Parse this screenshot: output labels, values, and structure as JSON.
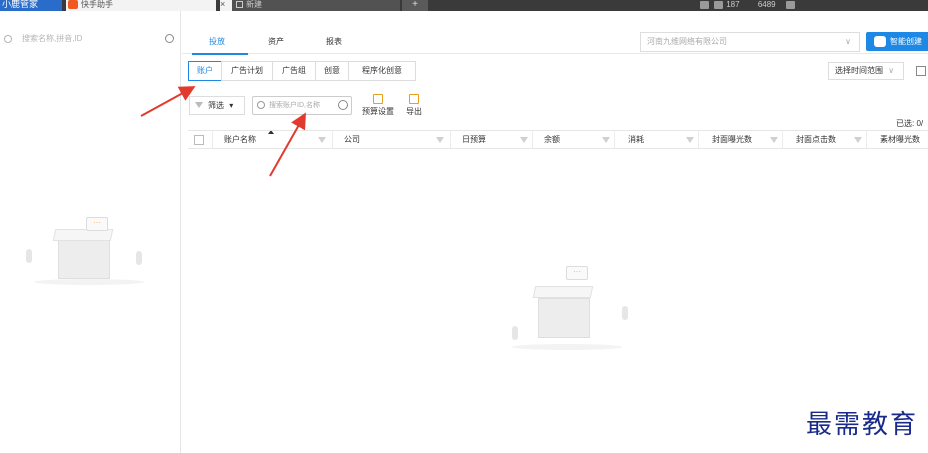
{
  "topbar": {
    "app_title": "小鹿管家",
    "tab2_label": "快手助手",
    "tab2_close": "×",
    "new_tab_label": "新建",
    "new_tab_plus": "+",
    "status_count": "187",
    "status_id": "6489"
  },
  "left": {
    "search_placeholder": "搜索名称,拼音,ID"
  },
  "main_tabs": [
    "投放",
    "资产",
    "报表"
  ],
  "company_select": {
    "value": "河南九维网络有限公司",
    "chevron": "∨"
  },
  "smart_button": "智能创建",
  "sub_tabs": [
    "账户",
    "广告计划",
    "广告组",
    "创意",
    "程序化创意"
  ],
  "time_range": {
    "label": "选择时间范围",
    "chevron": "∨"
  },
  "toolbar": {
    "filter_label": "筛选",
    "filter_caret": "▾",
    "search_placeholder": "搜索账户ID,名称",
    "budget_label": "预算设置",
    "export_label": "导出"
  },
  "selected_count": "已选: 0/",
  "table": {
    "columns": [
      "账户名称",
      "公司",
      "日预算",
      "余额",
      "消耗",
      "封面曝光数",
      "封面点击数",
      "素材曝光数"
    ]
  },
  "empty_bubble": "···",
  "watermark": "最需教育",
  "colors": {
    "accent": "#1e88e5",
    "arrow": "#e23b2e",
    "watermark": "#1a2a8a"
  }
}
